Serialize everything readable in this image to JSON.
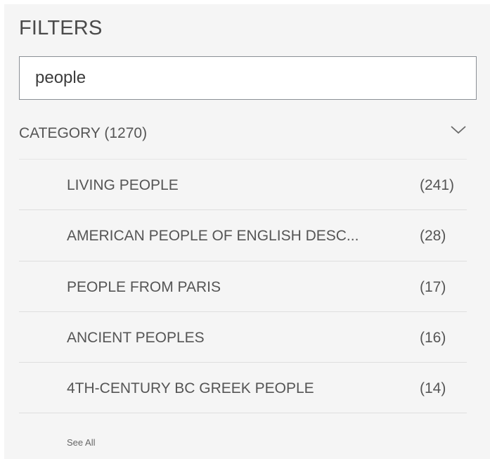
{
  "filters": {
    "title": "FILTERS",
    "search": {
      "value": "people",
      "placeholder": ""
    },
    "category": {
      "label": "CATEGORY (1270)",
      "expanded": true,
      "chevron_icon": "chevron-down-icon",
      "items": [
        {
          "label": "LIVING PEOPLE",
          "count": "(241)"
        },
        {
          "label": "AMERICAN PEOPLE OF ENGLISH DESC...",
          "count": "(28)"
        },
        {
          "label": "PEOPLE FROM PARIS",
          "count": "(17)"
        },
        {
          "label": "ANCIENT PEOPLES",
          "count": "(16)"
        },
        {
          "label": "4TH-CENTURY BC GREEK PEOPLE",
          "count": "(14)"
        }
      ],
      "see_all_label": "See All"
    },
    "colors": {
      "panel_background": "#f5f5f5",
      "text": "#555555",
      "input_border": "#8a8f95",
      "divider": "#dedede"
    }
  }
}
